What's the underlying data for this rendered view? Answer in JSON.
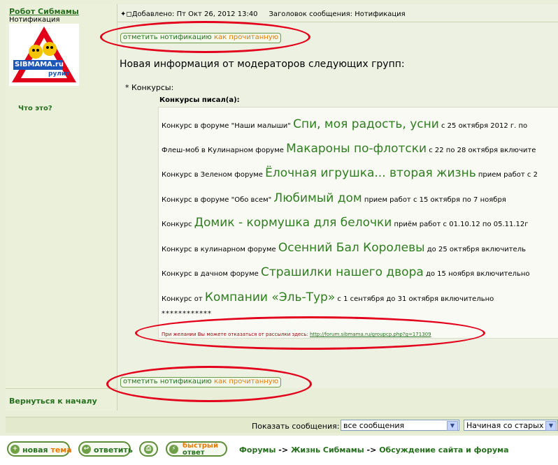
{
  "post": {
    "author": "Робот Сибмамы",
    "rank": "Нотификация",
    "avatar_text": "SIBMAMA.ru",
    "avatar_sub": "рулит",
    "whats_this": "Что это?",
    "back_to_top": "Вернуться к началу",
    "header_icon": "post-icon",
    "header_added_label": "Добавлено:",
    "header_added_value": "Пт Окт 26, 2012 13:40",
    "header_subject_label": "Заголовок сообщения:",
    "header_subject_value": "Нотификация",
    "mark_read_part1": "отметить нотификацию",
    "mark_read_part2": "как прочитанную",
    "new_info_title": "Новая информация от модераторов следующих групп:",
    "group_item": "* Конкурсы:",
    "quote_header": "Конкурсы писал(а):",
    "contests": [
      {
        "pre": "Конкурс в форуме \"Наши малыши\" ",
        "title": "Спи, моя радость, усни",
        "post": " с 25 октября 2012 г. по"
      },
      {
        "pre": "Флеш-моб в Кулинарном форуме ",
        "title": "Макароны по-флотски",
        "post": " с 22 по 28 октября включите"
      },
      {
        "pre": "Конкурс в Зеленом форуме ",
        "title": "Ёлочная игрушка... вторая жизнь",
        "post": " прием работ с 2"
      },
      {
        "pre": "Конкурс в форуме \"Обо всем\" ",
        "title": "Любимый дом",
        "post": " прием работ с 15 октября по 7 ноября"
      },
      {
        "pre": "Конкурс ",
        "title": "Домик - кормушка для белочки",
        "post": " приём работ с 01.10.12 по 05.11.12г"
      },
      {
        "pre": "Конкурс в кулинарном форуме ",
        "title": "Осенний Бал Королевы",
        "post": " до 25 октября включитель"
      },
      {
        "pre": "Конкурс в дачном форуме ",
        "title": "Страшилки нашего двора",
        "post": " до 15 ноября включительно"
      },
      {
        "pre": "Конкурс от ",
        "title": "Компании «Эль-Тур»",
        "post": " с 1 сентября до 31 октября включительно"
      }
    ],
    "stars": "************",
    "unsubscribe_text": "При желании Вы можете отказаться от рассылки здесь:",
    "unsubscribe_link": "http://forum.sibmama.ru/groupcp.php?g=171309"
  },
  "bottom_bar": {
    "show_label": "Показать сообщения:",
    "select1": "все сообщения",
    "select2": "Начиная со старых"
  },
  "footer": {
    "btn_new_topic_1": "новая",
    "btn_new_topic_2": "тема",
    "btn_reply": "ответить",
    "btn_quick_1": "быстрый",
    "btn_quick_2": "ответ",
    "crumb_forums": "Форумы",
    "crumb_arrow": "->",
    "crumb_life": "Жизнь Сибмамы",
    "crumb_discussion": "Обсуждение сайта и форума"
  },
  "colors": {
    "link_green": "#26701e",
    "accent_orange": "#e67a00",
    "annotation_red": "#e3001b"
  }
}
